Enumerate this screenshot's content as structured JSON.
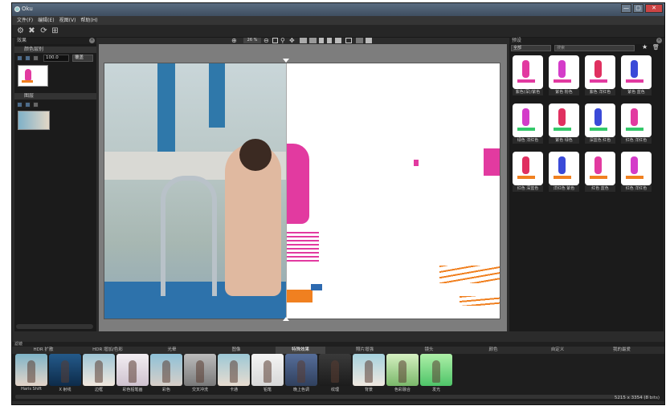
{
  "window": {
    "title": "Oku",
    "controls": [
      "—",
      "▢",
      "✕"
    ]
  },
  "menu": [
    "文件(F)",
    "编辑(E)",
    "视图(V)",
    "帮助(H)"
  ],
  "left_panel": {
    "title": "效果",
    "layer1_title": "颜色层别",
    "opacity_value": "100.0",
    "blend_mode": "覆盖",
    "layer2_title": "图层"
  },
  "view_toolbar": {
    "zoom": "26 %"
  },
  "right_panel": {
    "title": "预设",
    "filter_value": "全部",
    "search_value": "搜索",
    "presets": [
      "紫色(深)/紫色",
      "紫色 粉色",
      "紫色 洋红色",
      "紫色 蓝色",
      "绿色 洋红色",
      "紫色 绿色",
      "深蓝色 红色",
      "红色 洋红色",
      "红色 深蓝色",
      "洋红色 紫色",
      "红色 蓝色",
      "红色 洋红色"
    ]
  },
  "bottom": {
    "title": "滤镜",
    "categories": [
      "HDR 扩散",
      "HDR 增加/色彩",
      "光晕",
      "图像",
      "特殊效果",
      "照片增强",
      "镜头",
      "颜色",
      "自定义",
      "我的最爱"
    ],
    "active_category": 4,
    "effects": [
      "Haris Shift",
      "X 射线",
      "边框",
      "彩色铅笔画",
      "彩色",
      "交叉冲洗",
      "卡通",
      "铅笔",
      "晚上色调",
      "纹理",
      "背景",
      "色彩融合",
      "发光"
    ],
    "status": "5215 x 3354 (8 bits)"
  },
  "colors": {
    "accent_magenta": "#e23aa0",
    "accent_orange": "#f08020"
  }
}
